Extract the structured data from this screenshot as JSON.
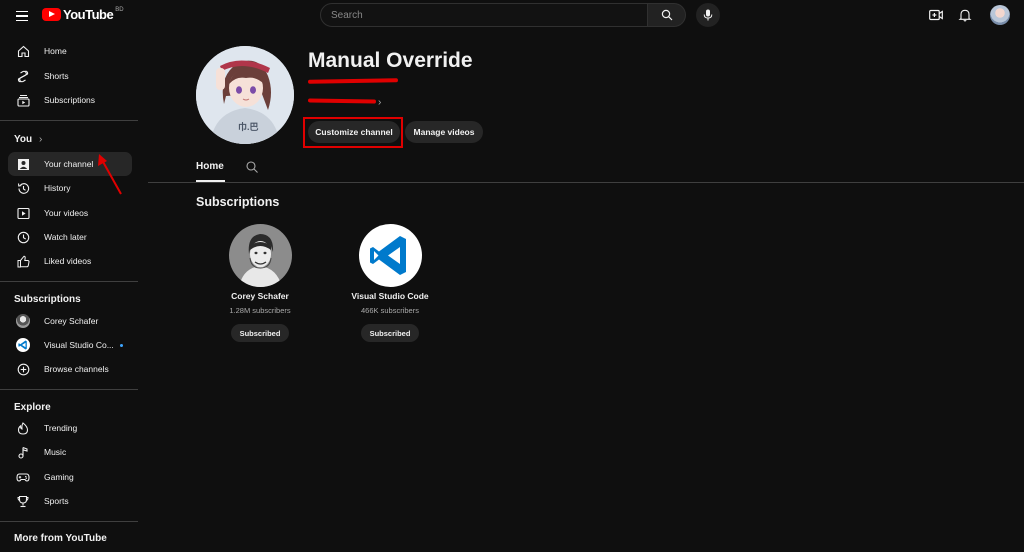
{
  "topbar": {
    "logo_text": "YouTube",
    "logo_country": "BD",
    "search_placeholder": "Search"
  },
  "sidebar": {
    "main": [
      {
        "label": "Home",
        "icon": "home-icon"
      },
      {
        "label": "Shorts",
        "icon": "shorts-icon"
      },
      {
        "label": "Subscriptions",
        "icon": "subscriptions-icon"
      }
    ],
    "you_heading": "You",
    "you": [
      {
        "label": "Your channel",
        "icon": "your-channel-icon",
        "active": true
      },
      {
        "label": "History",
        "icon": "history-icon"
      },
      {
        "label": "Your videos",
        "icon": "your-videos-icon"
      },
      {
        "label": "Watch later",
        "icon": "watch-later-icon"
      },
      {
        "label": "Liked videos",
        "icon": "liked-videos-icon"
      }
    ],
    "subscriptions_heading": "Subscriptions",
    "subscriptions": [
      {
        "label": "Corey Schafer"
      },
      {
        "label": "Visual Studio Co..."
      },
      {
        "label": "Browse channels",
        "icon": "browse-channels-icon"
      }
    ],
    "explore_heading": "Explore",
    "explore": [
      {
        "label": "Trending",
        "icon": "trending-icon"
      },
      {
        "label": "Music",
        "icon": "music-icon"
      },
      {
        "label": "Gaming",
        "icon": "gaming-icon"
      },
      {
        "label": "Sports",
        "icon": "sports-icon"
      }
    ],
    "more_heading": "More from YouTube"
  },
  "channel": {
    "name": "Manual Override",
    "customize_label": "Customize channel",
    "manage_label": "Manage videos",
    "more_chevron": "›"
  },
  "tabs": {
    "home_label": "Home"
  },
  "subscriptions_section": {
    "title": "Subscriptions",
    "cards": [
      {
        "name": "Corey Schafer",
        "subscribers": "1.28M subscribers",
        "button": "Subscribed"
      },
      {
        "name": "Visual Studio Code",
        "subscribers": "466K subscribers",
        "button": "Subscribed"
      }
    ]
  },
  "colors": {
    "background": "#0f0f0f",
    "annotation_red": "#e00000",
    "vscode_blue": "#007acc"
  }
}
